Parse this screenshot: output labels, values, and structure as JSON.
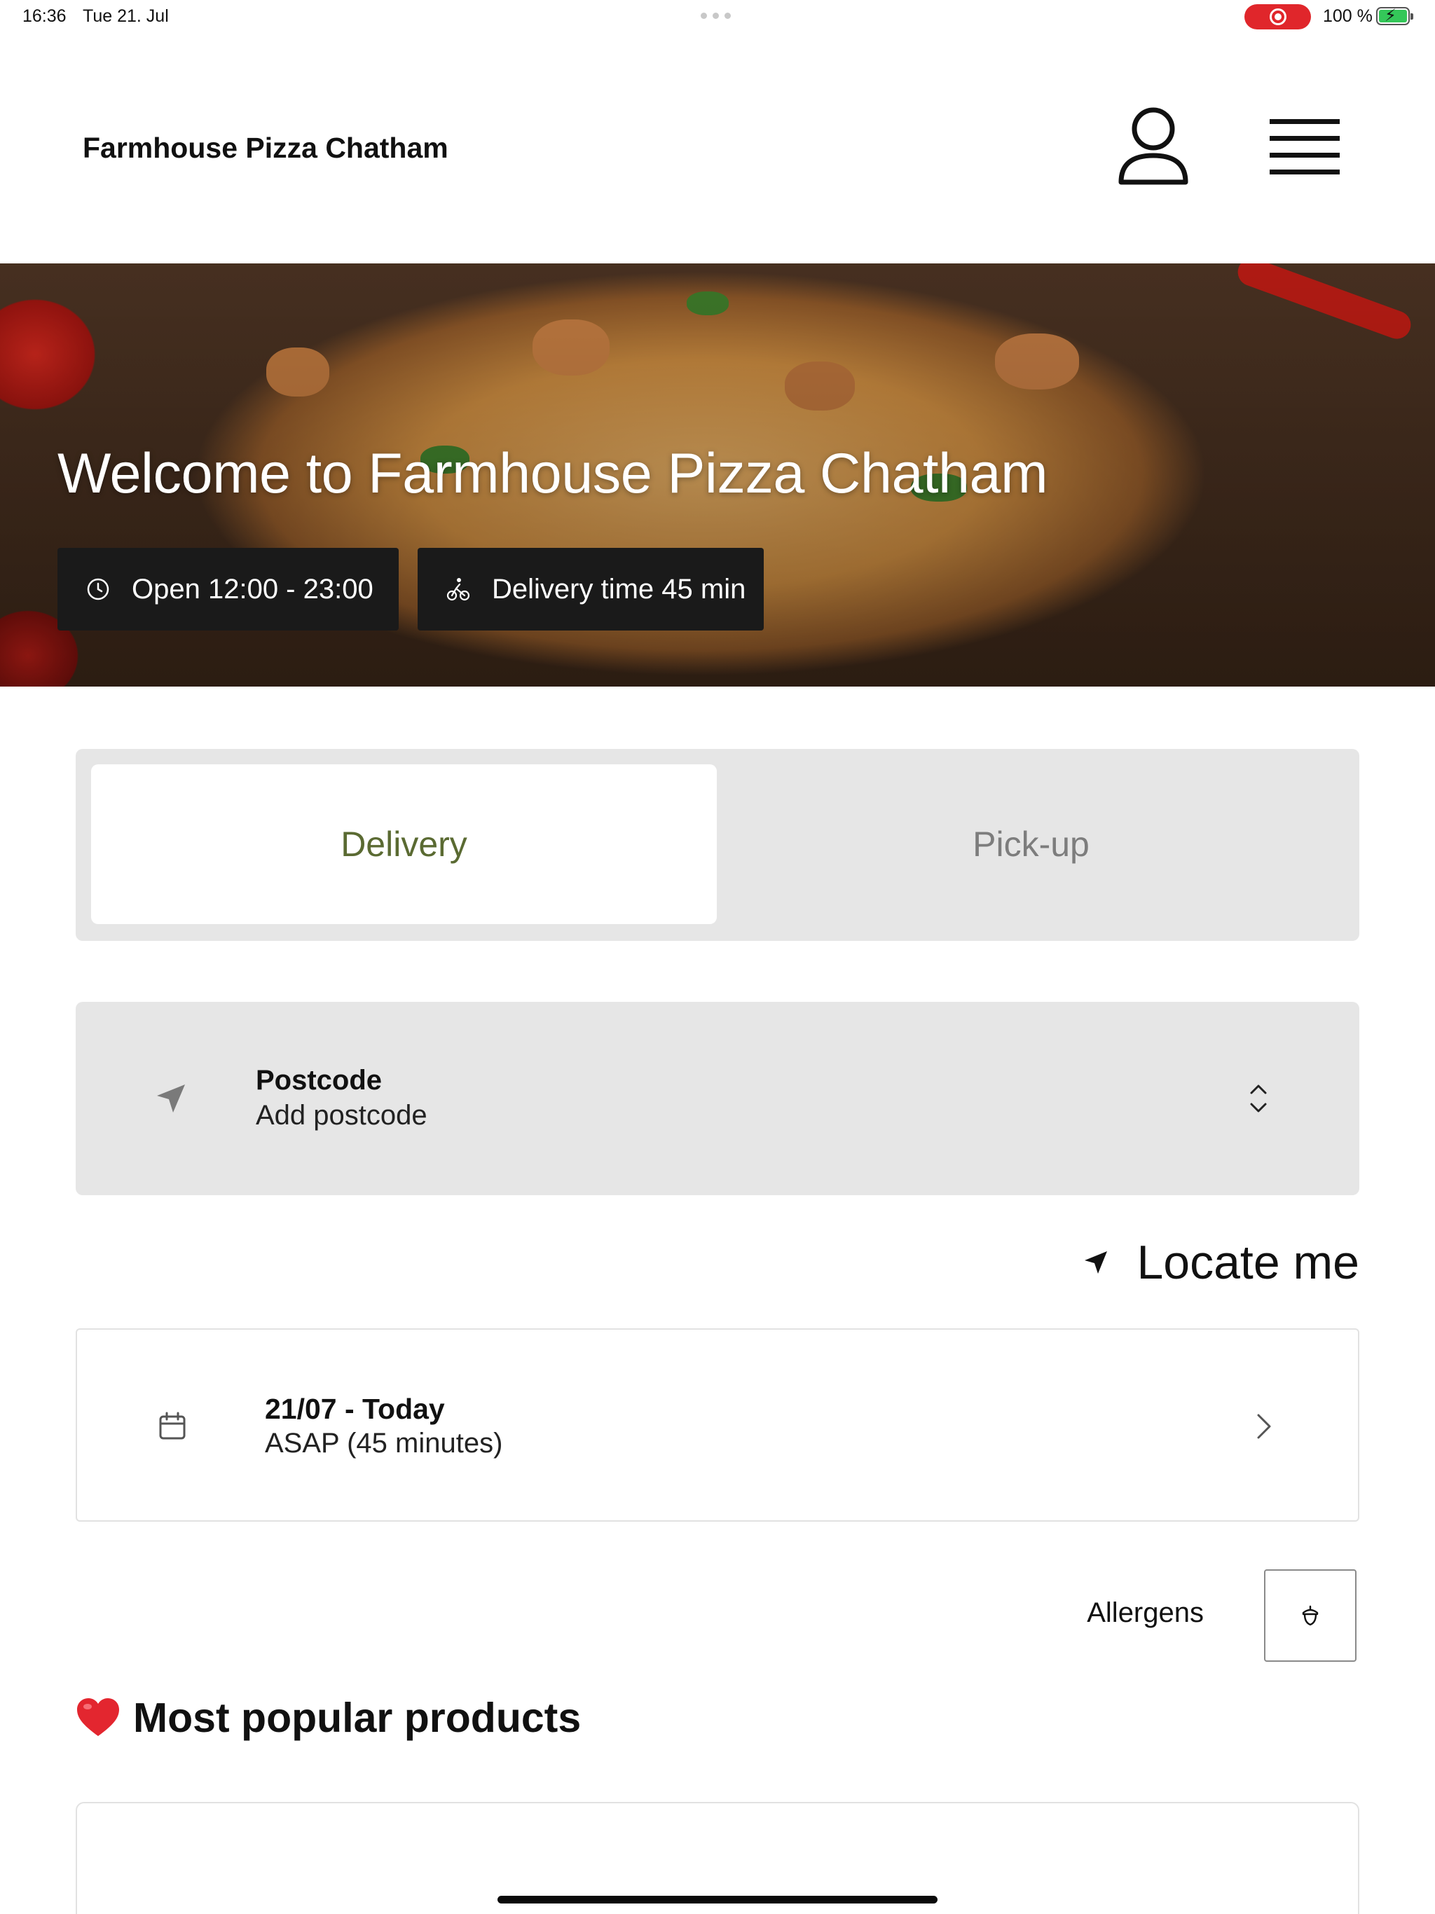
{
  "status_bar": {
    "time": "16:36",
    "date": "Tue 21. Jul",
    "battery": "100 %"
  },
  "header": {
    "brand": "Farmhouse Pizza Chatham",
    "user_icon": "user-icon",
    "menu_icon": "menu-icon"
  },
  "hero": {
    "title": "Welcome to Farmhouse Pizza Chatham",
    "open_hours": "Open 12:00 - 23:00",
    "delivery_time": "Delivery time 45 min"
  },
  "order_mode": {
    "options": [
      {
        "label": "Delivery",
        "selected": true
      },
      {
        "label": "Pick-up",
        "selected": false
      }
    ]
  },
  "postcode": {
    "label": "Postcode",
    "value": "Add postcode"
  },
  "locate_me": {
    "label": "Locate me"
  },
  "schedule": {
    "label": "21/07 - Today",
    "value": "ASAP (45 minutes)"
  },
  "allergens": {
    "label": "Allergens"
  },
  "popular": {
    "heading": "Most popular products"
  },
  "colors": {
    "accent_selected_text": "#5a6a32",
    "chip_bg": "#1a1a1a",
    "panel_bg": "#e6e6e6",
    "recording": "#e0262b",
    "battery": "#34c759"
  }
}
